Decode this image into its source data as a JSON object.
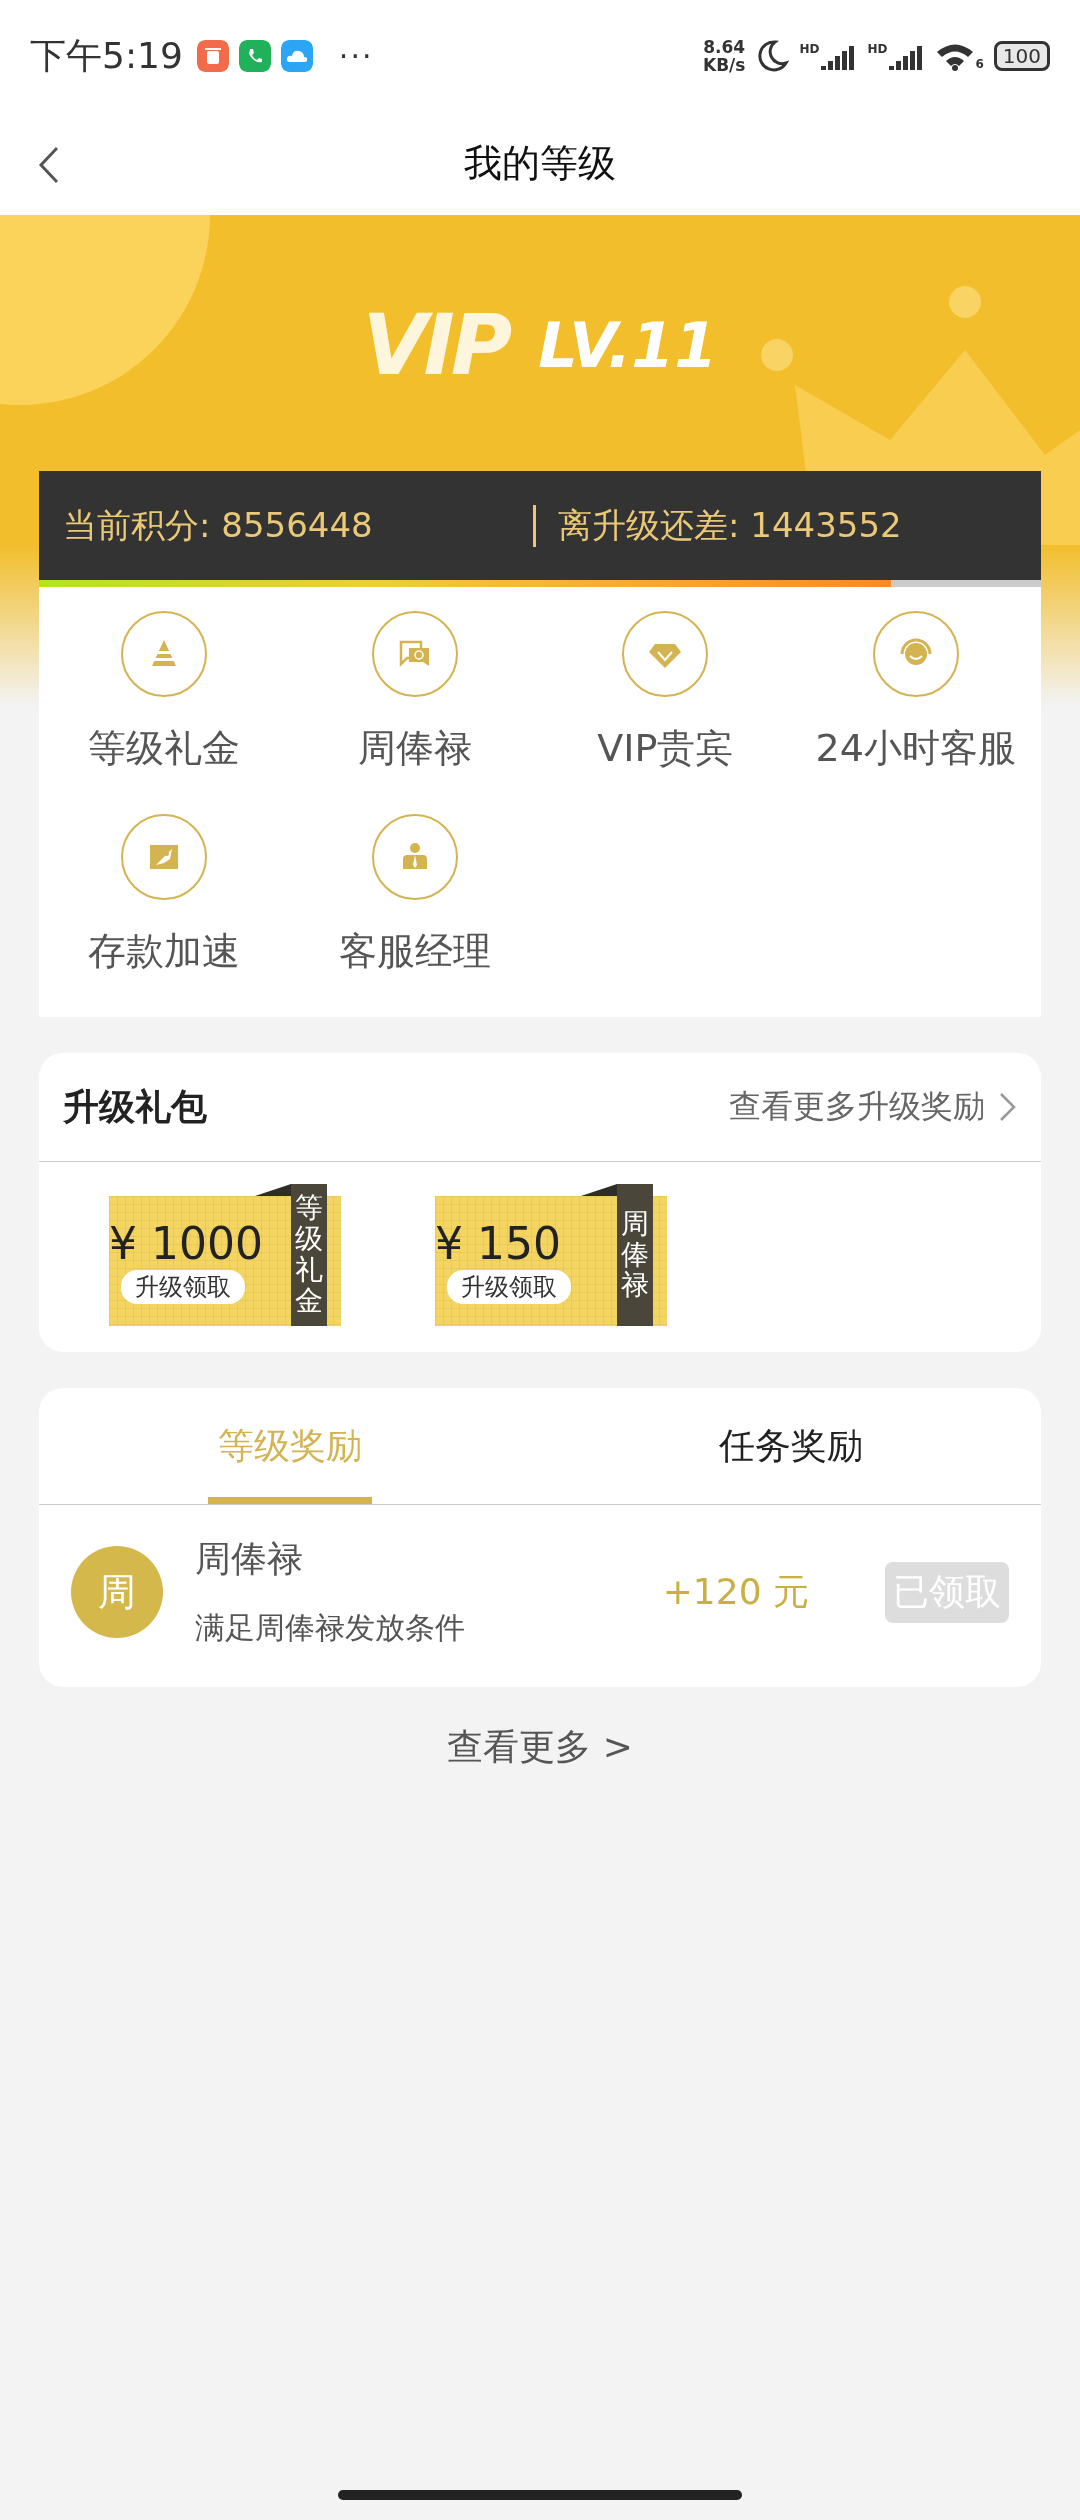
{
  "status_bar": {
    "time": "下午5:19",
    "more": "···",
    "net_speed": "8.64",
    "net_unit": "KB/s",
    "signal_labels": [
      "HD",
      "HD"
    ],
    "wifi_label": "6",
    "battery": "100"
  },
  "header": {
    "title": "我的等级"
  },
  "vip": {
    "logo": "VIP",
    "level": "LV.11"
  },
  "points": {
    "current": "当前积分: 8556448",
    "remaining": "离升级还差: 1443552",
    "level": 0.85
  },
  "benefits": [
    {
      "label": "等级礼金"
    },
    {
      "label": "周俸禄"
    },
    {
      "label": "VIP贵宾"
    },
    {
      "label": "24小时客服"
    },
    {
      "label": "存款加速"
    },
    {
      "label": "客服经理"
    }
  ],
  "upgrade_pack": {
    "title": "升级礼包",
    "more": "查看更多升级奖励",
    "tickets": [
      {
        "amount": "¥ 1000",
        "action": "升级领取",
        "ribbon": "等级礼金"
      },
      {
        "amount": "¥ 150",
        "action": "升级领取",
        "ribbon": "周俸禄"
      }
    ]
  },
  "rewards": {
    "tabs": [
      {
        "label": "等级奖励",
        "selected": true
      },
      {
        "label": "任务奖励",
        "selected": false
      }
    ],
    "items": [
      {
        "badge": "周",
        "title": "周俸禄",
        "description": "满足周俸禄发放条件",
        "amount": "+120 元",
        "button": "已领取",
        "claimed": true
      }
    ]
  },
  "view_more": "查看更多 >"
}
